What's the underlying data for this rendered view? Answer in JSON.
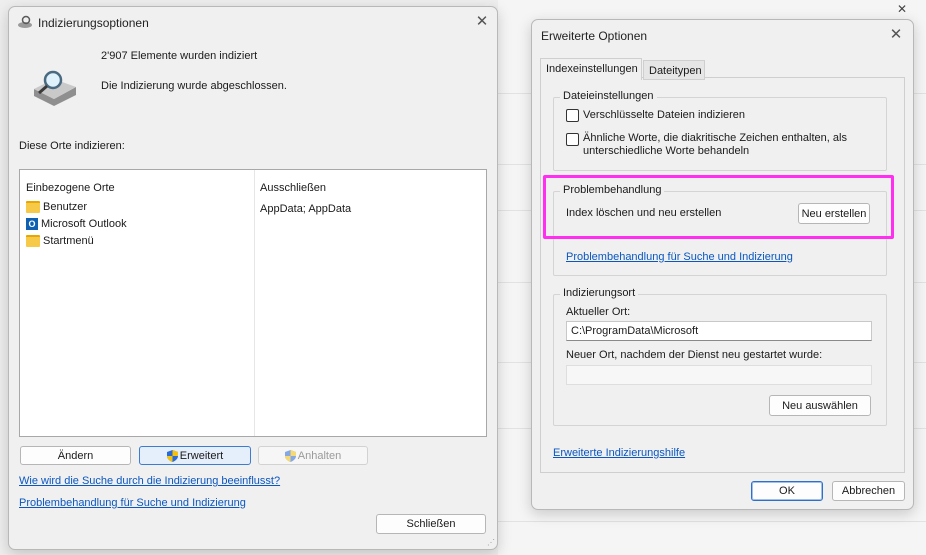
{
  "win1": {
    "title": "Indizierungsoptionen",
    "status_count": "2'907 Elemente wurden indiziert",
    "status_msg": "Die Indizierung wurde abgeschlossen.",
    "locations_label": "Diese Orte indizieren:",
    "col_included": "Einbezogene Orte",
    "col_excluded": "Ausschließen",
    "rows": [
      {
        "name": "Benutzer",
        "exclude": "AppData; AppData"
      },
      {
        "name": "Microsoft Outlook",
        "exclude": ""
      },
      {
        "name": "Startmenü",
        "exclude": ""
      }
    ],
    "btn_change": "Ändern",
    "btn_advanced": "Erweitert",
    "btn_pause": "Anhalten",
    "link_how": "Wie wird die Suche durch die Indizierung beeinflusst?",
    "link_trouble": "Problembehandlung für Suche und Indizierung",
    "btn_close": "Schließen"
  },
  "win2": {
    "title": "Erweiterte Optionen",
    "tab_index": "Indexeinstellungen",
    "tab_types": "Dateitypen",
    "group_files": "Dateieinstellungen",
    "chk_encrypted": "Verschlüsselte Dateien indizieren",
    "chk_similar_1": "Ähnliche Worte, die diakritische Zeichen enthalten, als",
    "chk_similar_2": "unterschiedliche Worte behandeln",
    "group_trouble": "Problembehandlung",
    "rebuild_label": "Index löschen und neu erstellen",
    "btn_rebuild": "Neu erstellen",
    "link_trouble": "Problembehandlung für Suche und Indizierung",
    "group_location": "Indizierungsort",
    "current_label": "Aktueller Ort:",
    "current_value": "C:\\ProgramData\\Microsoft",
    "new_label": "Neuer Ort, nachdem der Dienst neu gestartet wurde:",
    "new_value": "",
    "btn_select": "Neu auswählen",
    "link_help": "Erweiterte Indizierungshilfe",
    "btn_ok": "OK",
    "btn_cancel": "Abbrechen"
  },
  "colors": {
    "highlight": "#ff2ef0",
    "link": "#0a57c2",
    "accent": "#3b7bd0"
  }
}
